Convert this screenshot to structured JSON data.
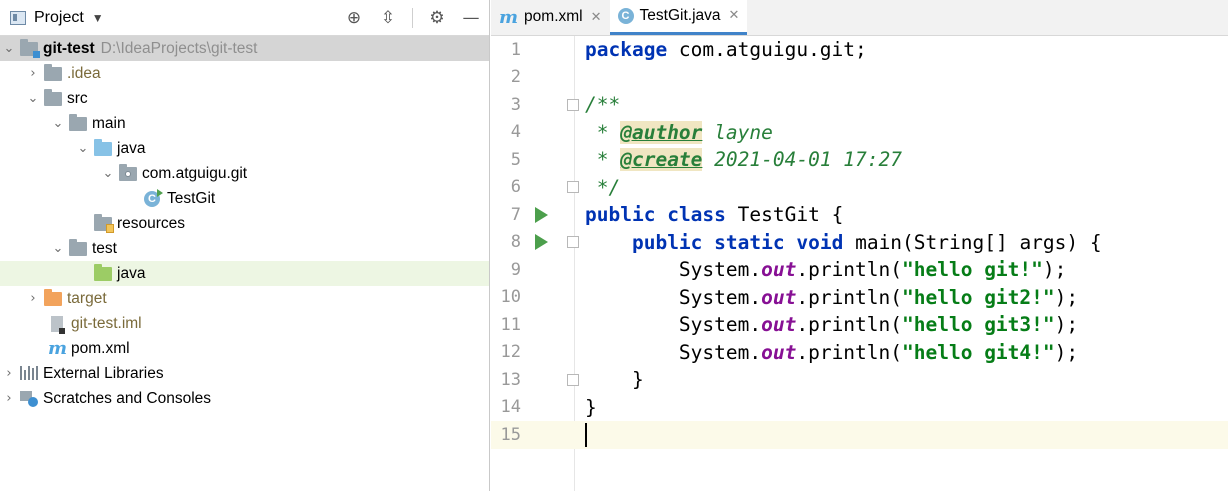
{
  "project_panel": {
    "title": "Project",
    "tree": [
      {
        "label": "git-test",
        "path": "D:\\IdeaProjects\\git-test"
      },
      {
        "label": ".idea"
      },
      {
        "label": "src"
      },
      {
        "label": "main"
      },
      {
        "label": "java"
      },
      {
        "label": "com.atguigu.git"
      },
      {
        "label": "TestGit"
      },
      {
        "label": "resources"
      },
      {
        "label": "test"
      },
      {
        "label": "java"
      },
      {
        "label": "target"
      },
      {
        "label": "git-test.iml"
      },
      {
        "label": "pom.xml"
      },
      {
        "label": "External Libraries"
      },
      {
        "label": "Scratches and Consoles"
      }
    ]
  },
  "editor": {
    "tabs": [
      {
        "label": "pom.xml",
        "icon": "maven-icon",
        "active": false
      },
      {
        "label": "TestGit.java",
        "icon": "java-class-icon",
        "active": true
      }
    ],
    "lines": [
      {
        "num": "1",
        "text": "package com.atguigu.git;"
      },
      {
        "num": "2",
        "text": ""
      },
      {
        "num": "3",
        "text": "/**"
      },
      {
        "num": "4",
        "text": " * @author layne"
      },
      {
        "num": "5",
        "text": " * @create 2021-04-01 17:27"
      },
      {
        "num": "6",
        "text": " */"
      },
      {
        "num": "7",
        "text": "public class TestGit {"
      },
      {
        "num": "8",
        "text": "    public static void main(String[] args) {"
      },
      {
        "num": "9",
        "text": "        System.out.println(\"hello git!\");"
      },
      {
        "num": "10",
        "text": "        System.out.println(\"hello git2!\");"
      },
      {
        "num": "11",
        "text": "        System.out.println(\"hello git3!\");"
      },
      {
        "num": "12",
        "text": "        System.out.println(\"hello git4!\");"
      },
      {
        "num": "13",
        "text": "    }"
      },
      {
        "num": "14",
        "text": "}"
      },
      {
        "num": "15",
        "text": ""
      }
    ],
    "tokens": {
      "package_kw": "package",
      "package_name": " com.atguigu.git;",
      "doc_open": "/**",
      "doc_star": " * ",
      "author_tag": "@author",
      "author_val": " layne",
      "create_tag": "@create",
      "create_val": " 2021-04-01 17:27",
      "doc_close": " */",
      "public_kw": "public",
      "class_kw": "class",
      "class_name": " TestGit {",
      "static_kw": "static",
      "void_kw": "void",
      "main_sig": " main(String[] args) {",
      "system": "System.",
      "out": "out",
      "println": ".println(",
      "str1": "\"hello git!\"",
      "str2": "\"hello git2!\"",
      "str3": "\"hello git3!\"",
      "str4": "\"hello git4!\"",
      "close_stmt": ");",
      "close_inner": "    }",
      "close_outer": "}"
    }
  },
  "colors": {
    "keyword": "#0033b3",
    "comment": "#287f3a",
    "string": "#067d17",
    "field": "#871094",
    "tab_accent": "#4083c9",
    "run_icon": "#4c9f4c"
  }
}
